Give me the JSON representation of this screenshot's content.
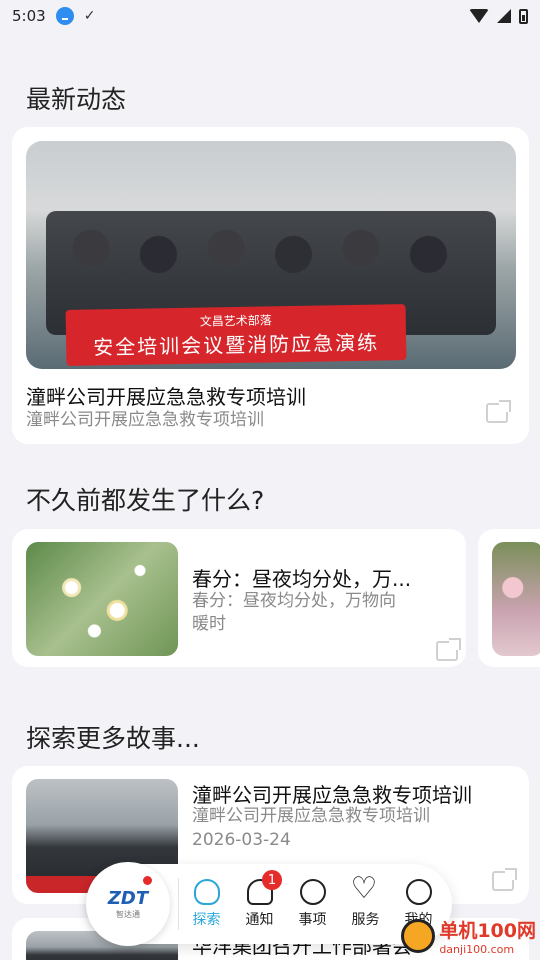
{
  "status": {
    "time": "5:03"
  },
  "sections": {
    "latest": "最新动态",
    "recent": "不久前都发生了什么?",
    "explore": "探索更多故事..."
  },
  "hero": {
    "banner_line1": "文昌艺术部落",
    "banner_line2": "安全培训会议暨消防应急演练",
    "title": "潼畔公司开展应急急救专项培训",
    "subtitle": "潼畔公司开展应急急救专项培训"
  },
  "recent_card": {
    "title": "春分：昼夜均分处，万...",
    "subtitle_line1": "春分：昼夜均分处，万物向",
    "subtitle_line2": "暖时"
  },
  "story_card": {
    "title": "潼畔公司开展应急急救专项培训",
    "subtitle": "潼畔公司开展应急急救专项培训",
    "date": "2026-03-24"
  },
  "peek_card": {
    "title": "华洋集团召开工作部署会"
  },
  "nav": {
    "logo_text": "ZDT",
    "logo_sub": "智达通",
    "items": [
      {
        "label": "探索"
      },
      {
        "label": "通知"
      },
      {
        "label": "事项"
      },
      {
        "label": "服务"
      },
      {
        "label": "我的"
      }
    ],
    "notify_badge": "1"
  },
  "watermark": {
    "line1": "单机100网",
    "line2": "danji100.com"
  },
  "colors": {
    "accent": "#29a7d8",
    "badge": "#e62b2b",
    "brand": "#1f5fb3"
  }
}
